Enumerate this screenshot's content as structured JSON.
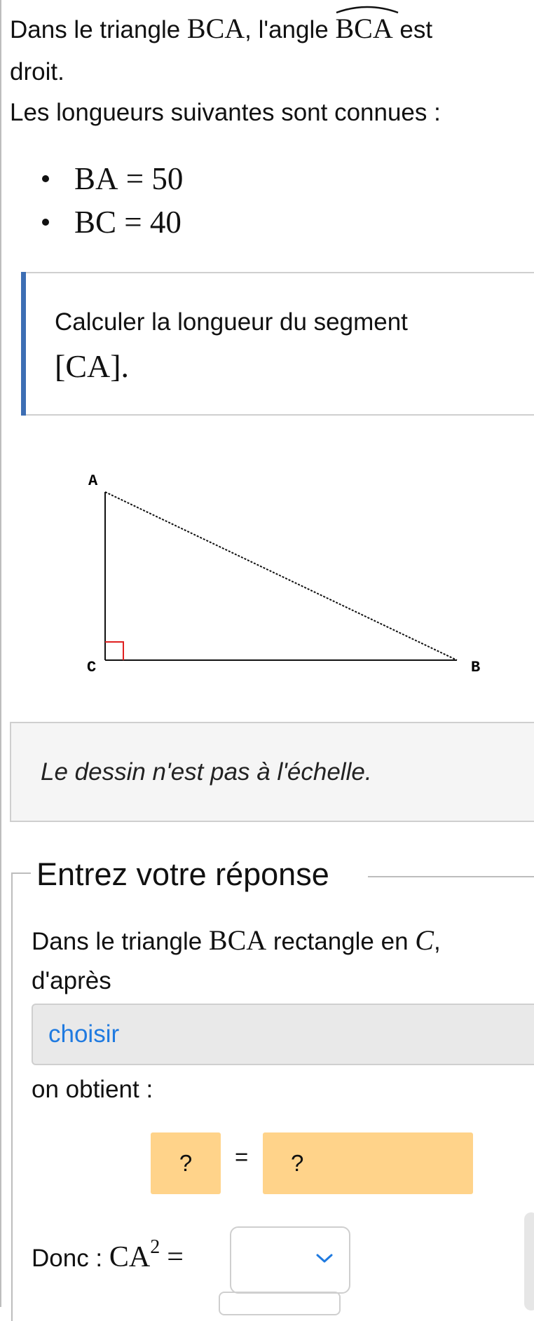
{
  "intro": {
    "prefix": "Dans le triangle ",
    "triangle": "BCA",
    "middle": ", l'angle ",
    "angle": "BCA",
    "suffix": " est",
    "line2": "droit."
  },
  "known_label": "Les longueurs suivantes sont connues :",
  "givens": [
    {
      "lhs": "BA",
      "op": "=",
      "rhs": "50"
    },
    {
      "lhs": "BC",
      "op": "=",
      "rhs": "40"
    }
  ],
  "task": {
    "line1": "Calculer la longueur du segment",
    "segment": "[CA]."
  },
  "figure": {
    "vertex_a": "A",
    "vertex_b": "B",
    "vertex_c": "C",
    "right_angle_color": "#e02020"
  },
  "scale_note": "Le dessin n'est pas à l'échelle.",
  "answer": {
    "legend": "Entrez votre réponse",
    "sentence_prefix": "Dans le triangle ",
    "sentence_triangle": "BCA",
    "sentence_middle": " rectangle en ",
    "sentence_vertex": "C",
    "sentence_suffix": ",",
    "sentence_line2": "d'après",
    "theorem_select": "choisir",
    "obtain": "on obtient :",
    "slot_left": "?",
    "equals": "=",
    "slot_right": "?",
    "donc": "Donc : ",
    "ca": "CA",
    "exponent": "2",
    "eq": "="
  },
  "colors": {
    "accent_bar": "#3d6eb4",
    "link_blue": "#1f7ae0",
    "slot_fill": "#ffd38a"
  },
  "icons": {
    "dropdown": "chevron-down-icon"
  }
}
